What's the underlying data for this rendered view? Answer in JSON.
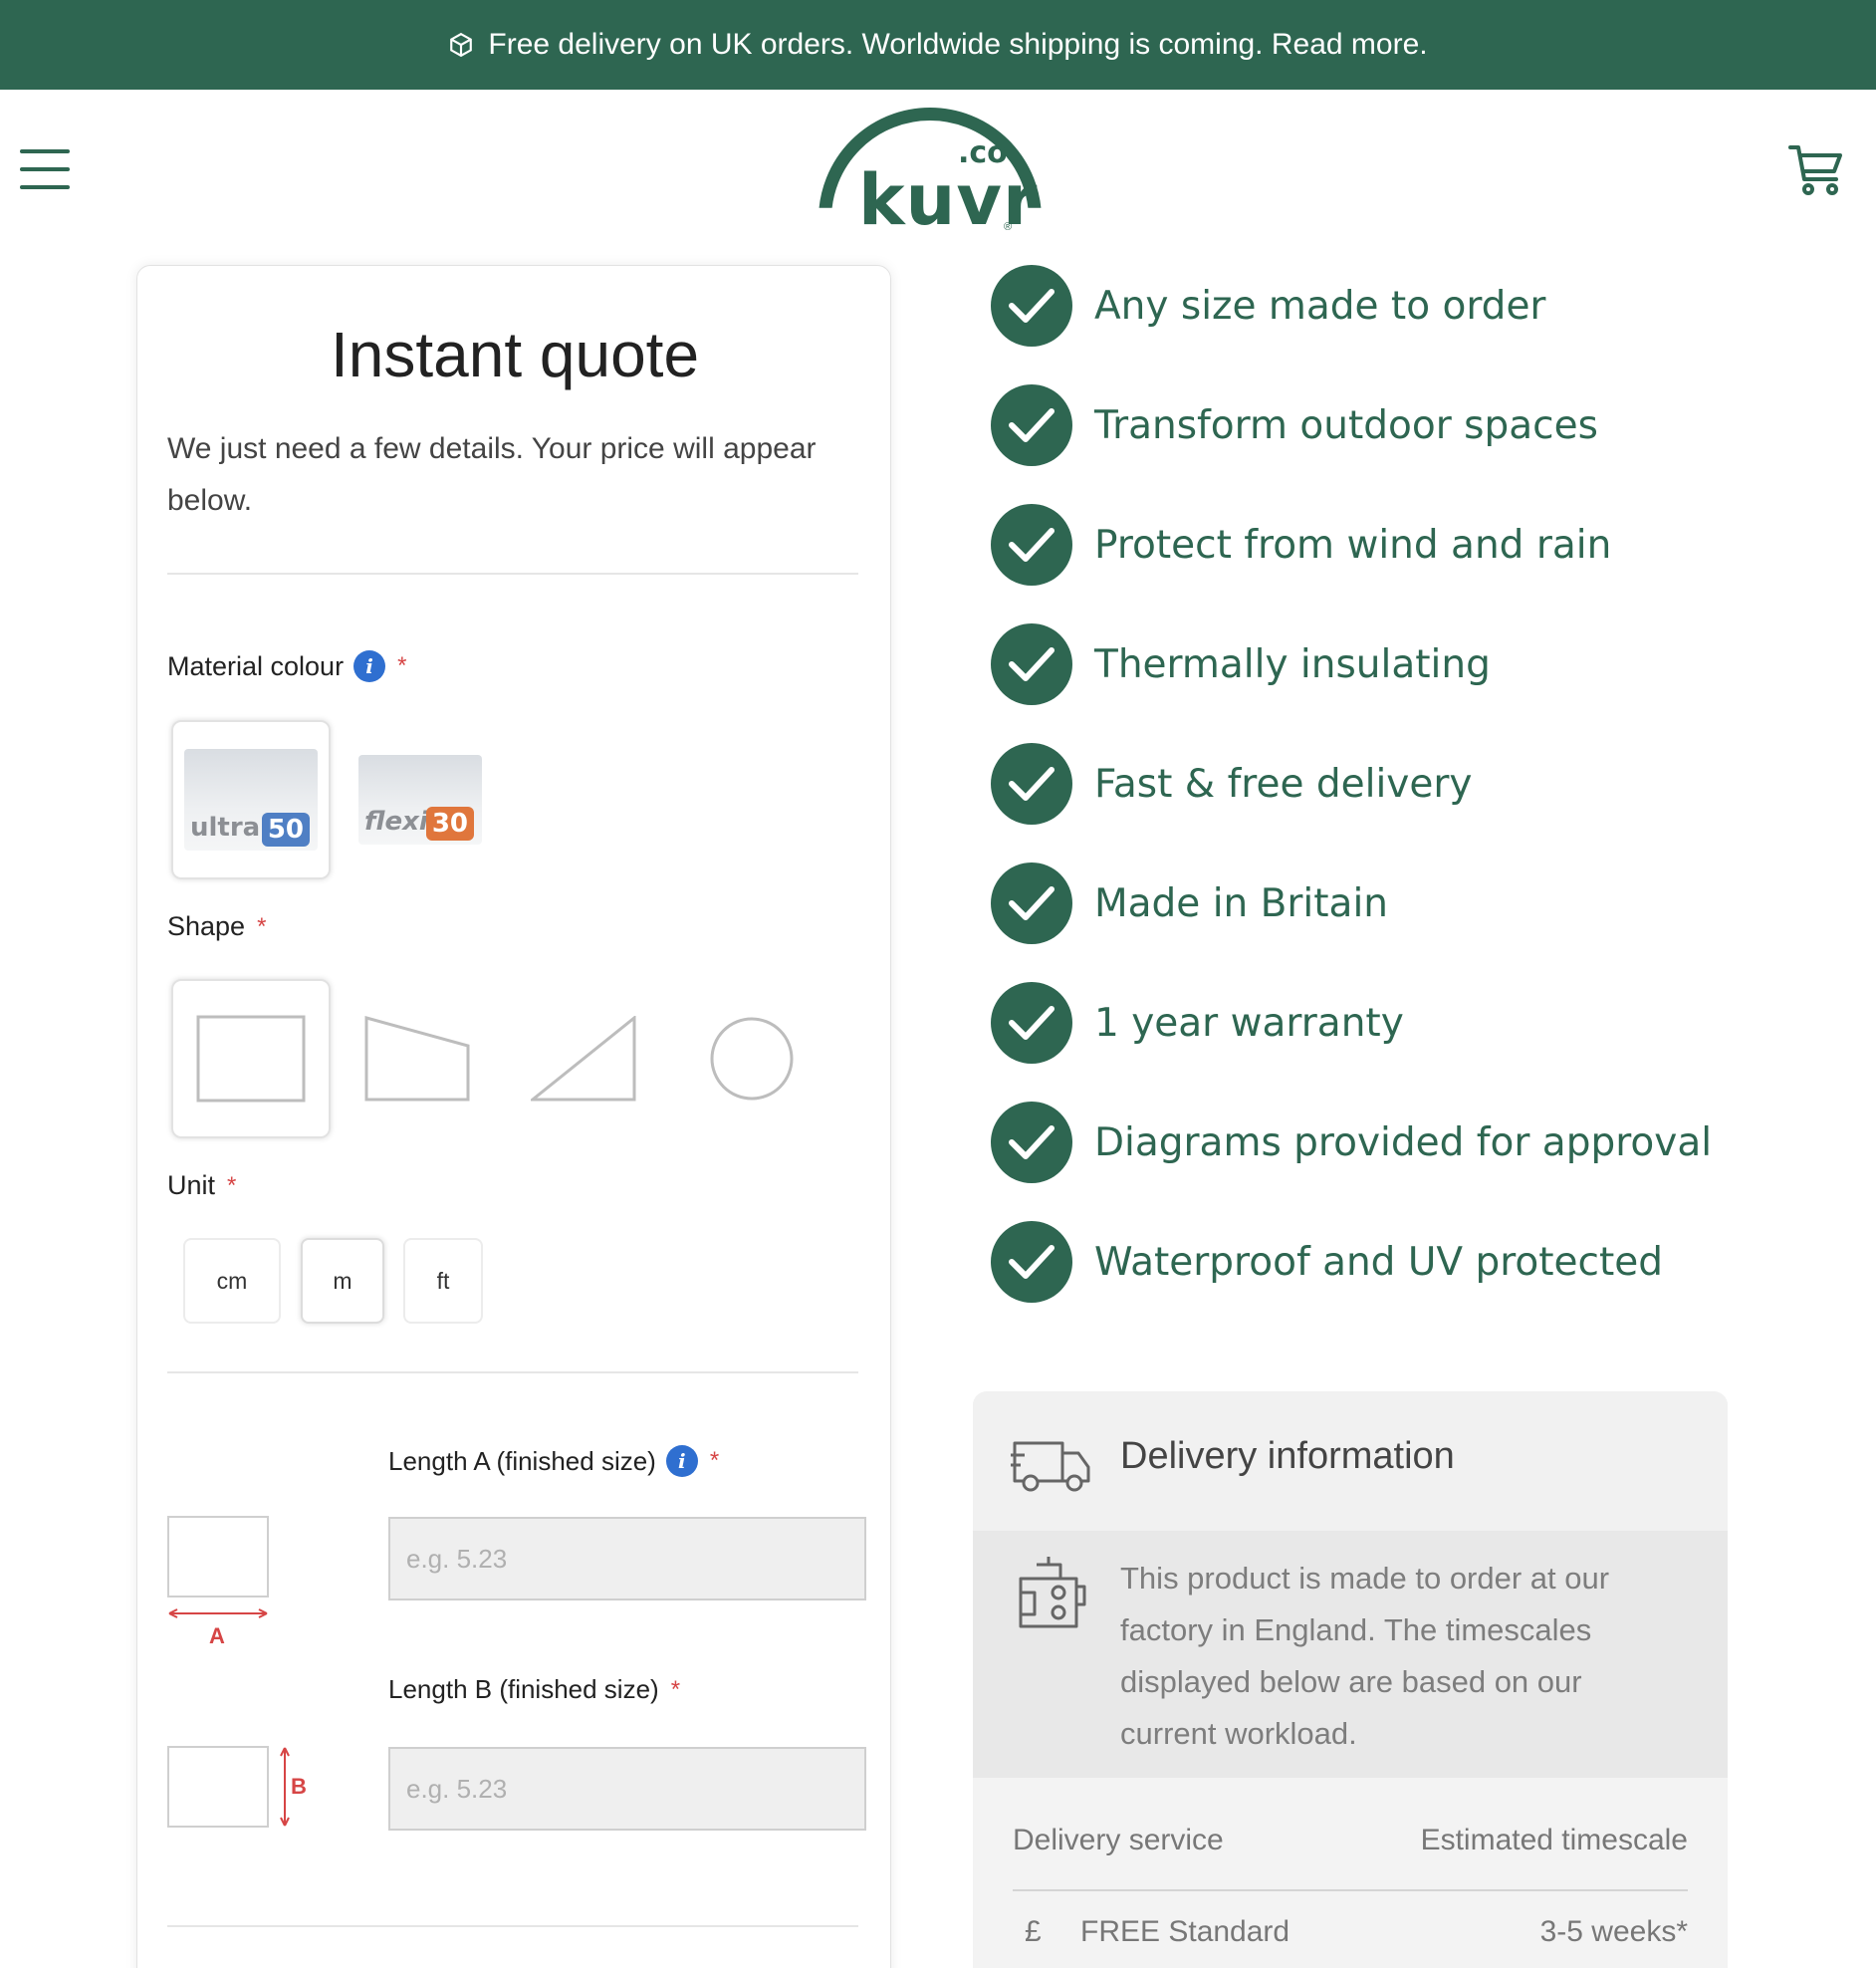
{
  "announcement": {
    "icon": "box-icon",
    "text": "Free delivery on UK orders. Worldwide shipping is coming. Read more."
  },
  "header": {
    "logo_text": "kuvr",
    "logo_suffix": ".co",
    "logo_reg": "®",
    "menu_icon": "menu-icon",
    "cart_icon": "cart-icon"
  },
  "quote": {
    "title": "Instant quote",
    "subtitle": "We just need a few details. Your price will appear below.",
    "material": {
      "label": "Material colour",
      "required_mark": "*",
      "options": [
        {
          "name": "ultra",
          "number": "50",
          "badge_color": "#4f7fc4",
          "selected": true
        },
        {
          "name": "flexi",
          "number": "30",
          "badge_color": "#e0763c",
          "selected": false
        }
      ]
    },
    "shape": {
      "label": "Shape",
      "required_mark": "*",
      "options": [
        "rectangle-shape-icon",
        "trapezoid-shape-icon",
        "triangle-shape-icon",
        "circle-shape-icon"
      ],
      "selected": "rectangle-shape-icon"
    },
    "unit": {
      "label": "Unit",
      "required_mark": "*",
      "options": [
        "cm",
        "m",
        "ft"
      ],
      "selected": "m"
    },
    "length_a": {
      "label": "Length A (finished size)",
      "required_mark": "*",
      "placeholder": "e.g. 5.23",
      "diagram_letter": "A"
    },
    "length_b": {
      "label": "Length B (finished size)",
      "required_mark": "*",
      "placeholder": "e.g. 5.23",
      "diagram_letter": "B"
    }
  },
  "features": [
    "Any size made to order",
    "Transform outdoor spaces",
    "Protect from wind and rain",
    "Thermally insulating",
    "Fast & free delivery",
    "Made in Britain",
    "1 year warranty",
    "Diagrams provided for approval",
    "Waterproof and UV protected"
  ],
  "delivery": {
    "title": "Delivery information",
    "note": "This product is made to order at our factory in England. The timescales displayed below are based on our current workload.",
    "col_service": "Delivery service",
    "col_timescale": "Estimated timescale",
    "rows": [
      {
        "icon": "£",
        "service": "FREE Standard",
        "timescale": "3-5 weeks*"
      }
    ]
  },
  "colors": {
    "brand_green": "#2e6651",
    "required_red": "#d64545",
    "info_blue": "#2f6fd0"
  }
}
